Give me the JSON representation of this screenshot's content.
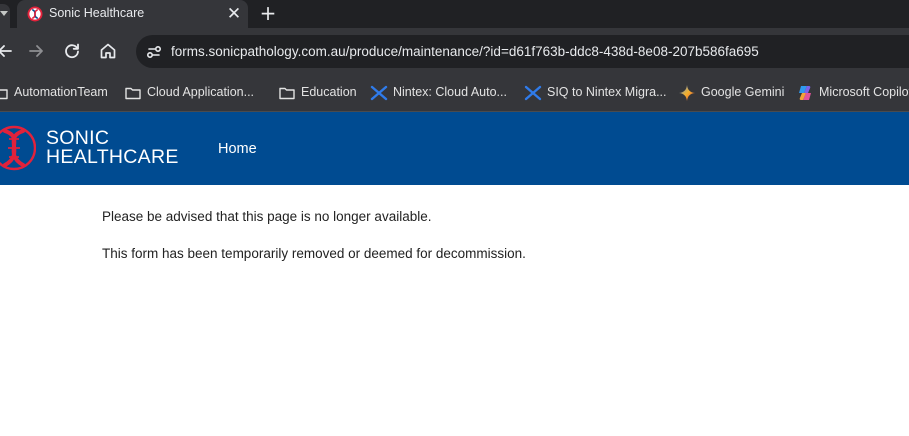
{
  "tab": {
    "title": "Sonic Healthcare",
    "close_glyph": "✕",
    "favicon": "sonic-healthcare-favicon"
  },
  "new_tab_glyph": "+",
  "toolbar": {
    "back_icon": "arrow-left-icon",
    "forward_icon": "arrow-right-icon",
    "reload_icon": "reload-icon",
    "home_icon": "home-icon"
  },
  "omnibox": {
    "url": "forms.sonicpathology.com.au/produce/maintenance/?id=d61f763b-ddc8-438d-8e08-207b586fa695",
    "site_info_icon": "tune-icon"
  },
  "bookmarks": [
    {
      "label": "AutomationTeam",
      "icon": "folder-icon"
    },
    {
      "label": "Cloud Application...",
      "icon": "folder-icon"
    },
    {
      "label": "Education",
      "icon": "folder-icon"
    },
    {
      "label": "Nintex: Cloud Auto...",
      "icon": "nintex-icon"
    },
    {
      "label": "SIQ to Nintex Migra...",
      "icon": "nintex-icon"
    },
    {
      "label": "Google Gemini",
      "icon": "gemini-icon"
    },
    {
      "label": "Microsoft Copilot",
      "icon": "copilot-icon"
    }
  ],
  "site": {
    "logo_line1": "SONIC",
    "logo_line2": "HEALTHCARE",
    "nav_home": "Home",
    "brand_color": "#004b91",
    "logo_accent": "#e2223b"
  },
  "content": {
    "line1": "Please be advised that this page is no longer available.",
    "line2": "This form has been temporarily removed or deemed for decommission."
  },
  "colors": {
    "tabstrip_bg": "#202124",
    "toolbar_bg": "#35363a",
    "omnibox_bg": "#202124"
  }
}
